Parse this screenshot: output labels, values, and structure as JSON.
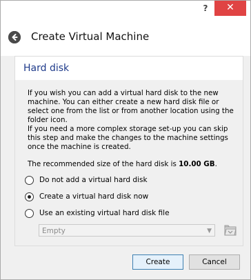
{
  "window": {
    "help_label": "?",
    "close_label": "✕"
  },
  "header": {
    "title": "Create Virtual Machine"
  },
  "section": {
    "title": "Hard disk"
  },
  "body": {
    "p1": "If you wish you can add a virtual hard disk to the new machine. You can either create a new hard disk file or select one from the list or from another location using the folder icon.",
    "p2": "If you need a more complex storage set-up you can skip this step and make the changes to the machine settings once the machine is created.",
    "p3_prefix": "The recommended size of the hard disk is ",
    "p3_value": "10.00 GB",
    "p3_suffix": "."
  },
  "options": [
    {
      "label": "Do not add a virtual hard disk",
      "checked": false
    },
    {
      "label": "Create a virtual hard disk now",
      "checked": true
    },
    {
      "label": "Use an existing virtual hard disk file",
      "checked": false
    }
  ],
  "existing_disk_select": {
    "value": "Empty"
  },
  "footer": {
    "create_label": "Create",
    "cancel_label": "Cancel"
  },
  "colors": {
    "close_button": "#e04343",
    "section_title": "#1e3a8a",
    "primary_button_border": "#3c7fb1"
  },
  "icons": {
    "back": "arrow-left-circle-icon",
    "folder": "folder-open-icon"
  }
}
